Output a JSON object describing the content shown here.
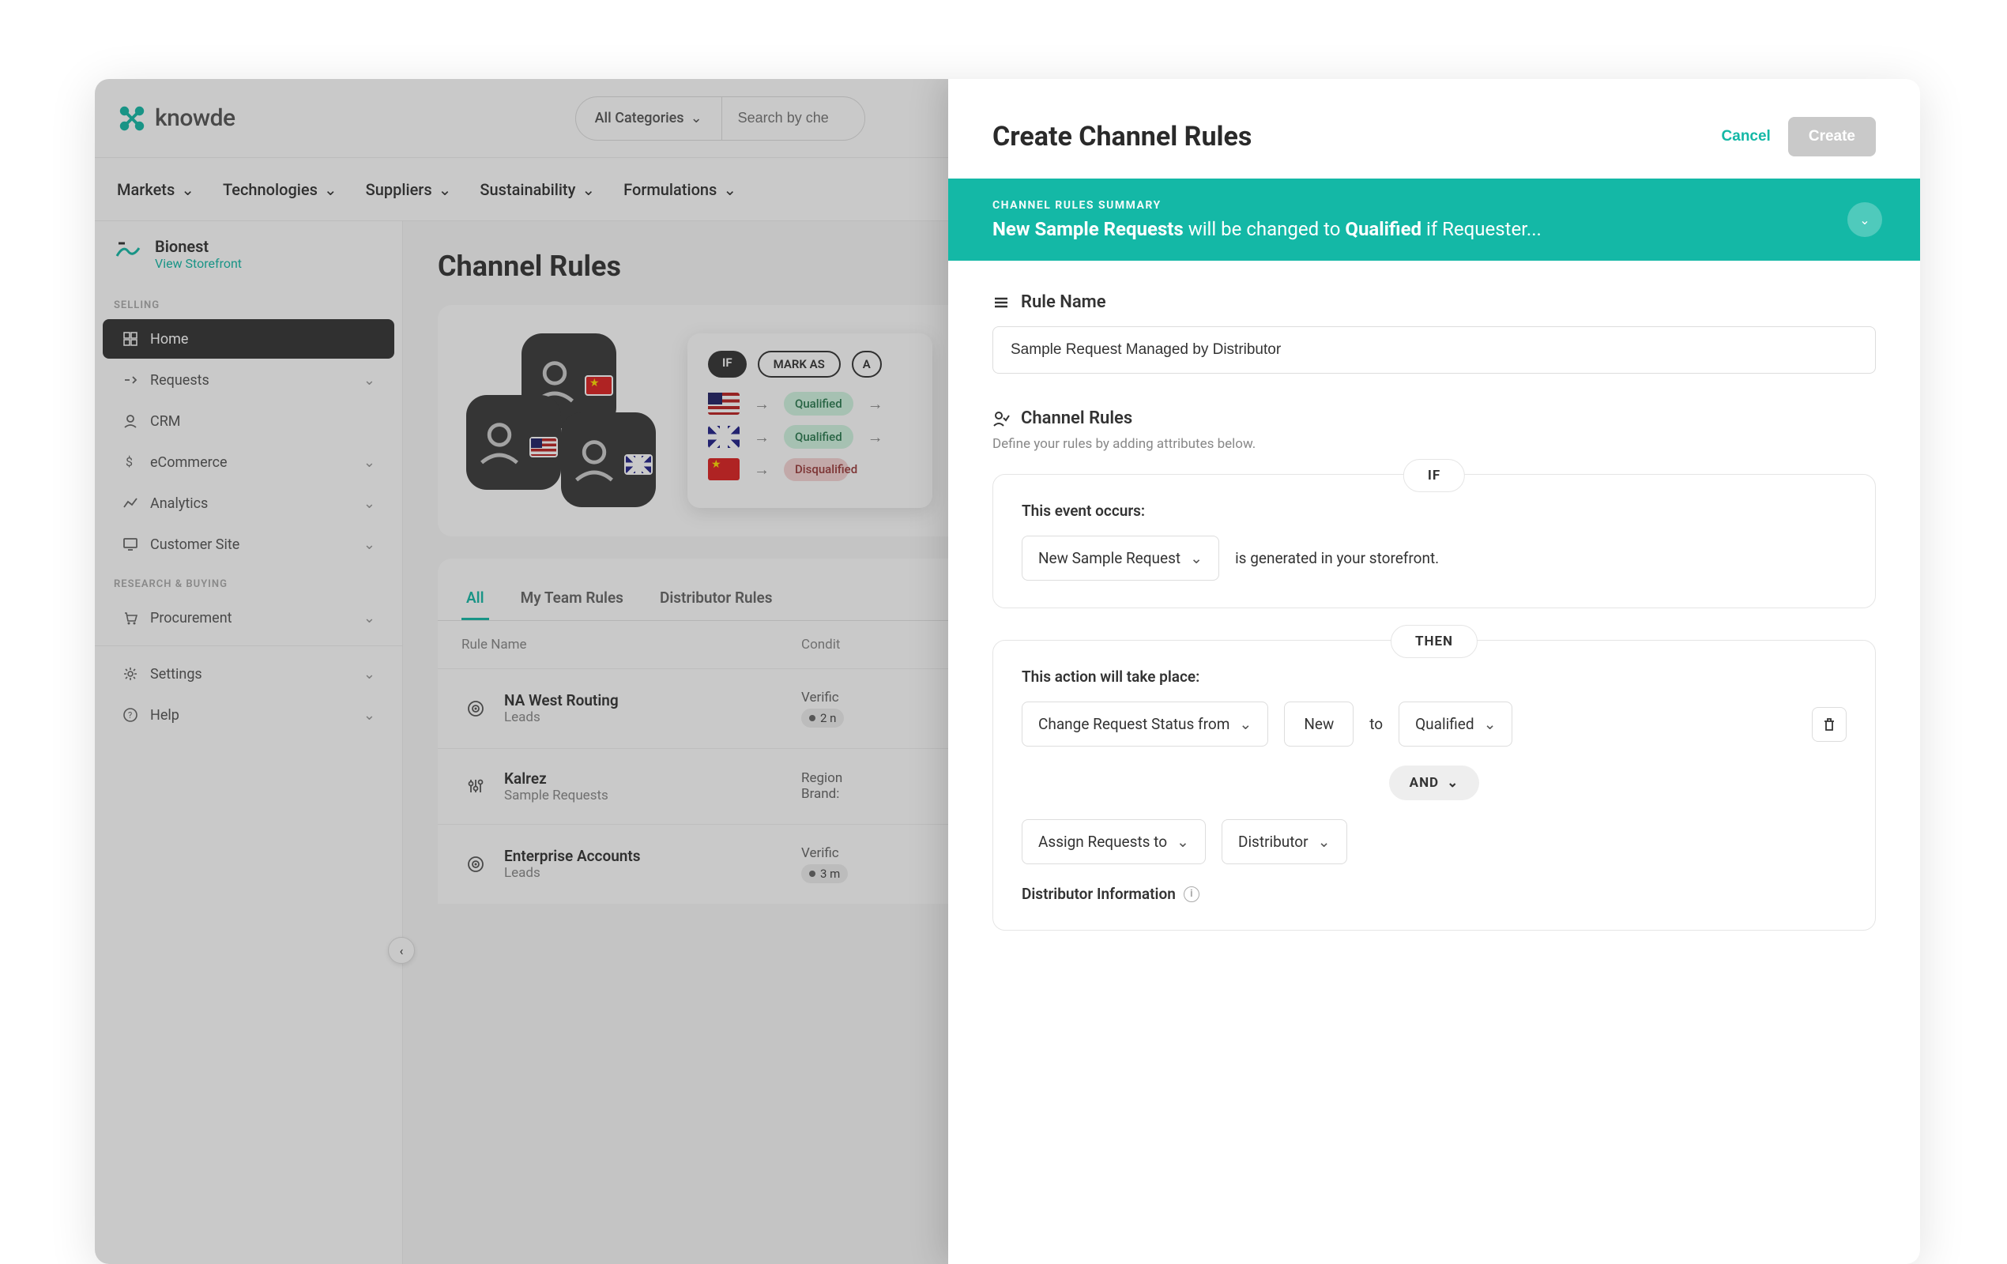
{
  "brand": {
    "name": "knowde"
  },
  "topbar": {
    "categories_label": "All Categories",
    "search_placeholder": "Search by che"
  },
  "nav": {
    "items": [
      "Markets",
      "Technologies",
      "Suppliers",
      "Sustainability",
      "Formulations"
    ]
  },
  "tenant": {
    "name": "Bionest",
    "view_link": "View Storefront"
  },
  "sidebar": {
    "section_selling": "SELLING",
    "section_research": "RESEARCH & BUYING",
    "items_selling": [
      {
        "label": "Home"
      },
      {
        "label": "Requests"
      },
      {
        "label": "CRM"
      },
      {
        "label": "eCommerce"
      },
      {
        "label": "Analytics"
      },
      {
        "label": "Customer Site"
      }
    ],
    "items_research": [
      {
        "label": "Procurement"
      }
    ],
    "items_footer": [
      {
        "label": "Settings"
      },
      {
        "label": "Help"
      }
    ]
  },
  "page": {
    "title": "Channel Rules"
  },
  "hero": {
    "chip_if": "IF",
    "chip_mark": "MARK AS",
    "chip_a": "A",
    "status_qualified": "Qualified",
    "status_disqualified": "Disqualified"
  },
  "tabs": {
    "items": [
      "All",
      "My Team Rules",
      "Distributor Rules"
    ]
  },
  "table": {
    "col_name": "Rule Name",
    "col_cond": "Condit",
    "rows": [
      {
        "name": "NA West Routing",
        "sub": "Leads",
        "cond": "Verific",
        "pill": "2 n"
      },
      {
        "name": "Kalrez",
        "sub": "Sample Requests",
        "cond1": "Region",
        "cond2": "Brand:"
      },
      {
        "name": "Enterprise Accounts",
        "sub": "Leads",
        "cond": "Verific",
        "pill": "3 m"
      }
    ]
  },
  "drawer": {
    "title": "Create Channel Rules",
    "cancel": "Cancel",
    "create": "Create",
    "summary_label": "CHANNEL RULES SUMMARY",
    "summary_b1": "New Sample Requests",
    "summary_mid": " will be changed to ",
    "summary_b2": "Qualified",
    "summary_end": " if Requester...",
    "rule_name_label": "Rule Name",
    "rule_name_value": "Sample Request Managed by Distributor",
    "channel_rules_label": "Channel Rules",
    "channel_rules_sub": "Define your rules by adding attributes below.",
    "if_tag": "IF",
    "if_label": "This event occurs:",
    "if_event": "New Sample Request",
    "if_suffix": "is generated in your storefront.",
    "then_tag": "THEN",
    "then_label": "This action will take place:",
    "then_action": "Change Request Status from",
    "then_from": "New",
    "then_to_word": "to",
    "then_to": "Qualified",
    "and_tag": "AND",
    "assign_label": "Assign Requests to",
    "assign_target": "Distributor",
    "dist_info": "Distributor Information"
  }
}
